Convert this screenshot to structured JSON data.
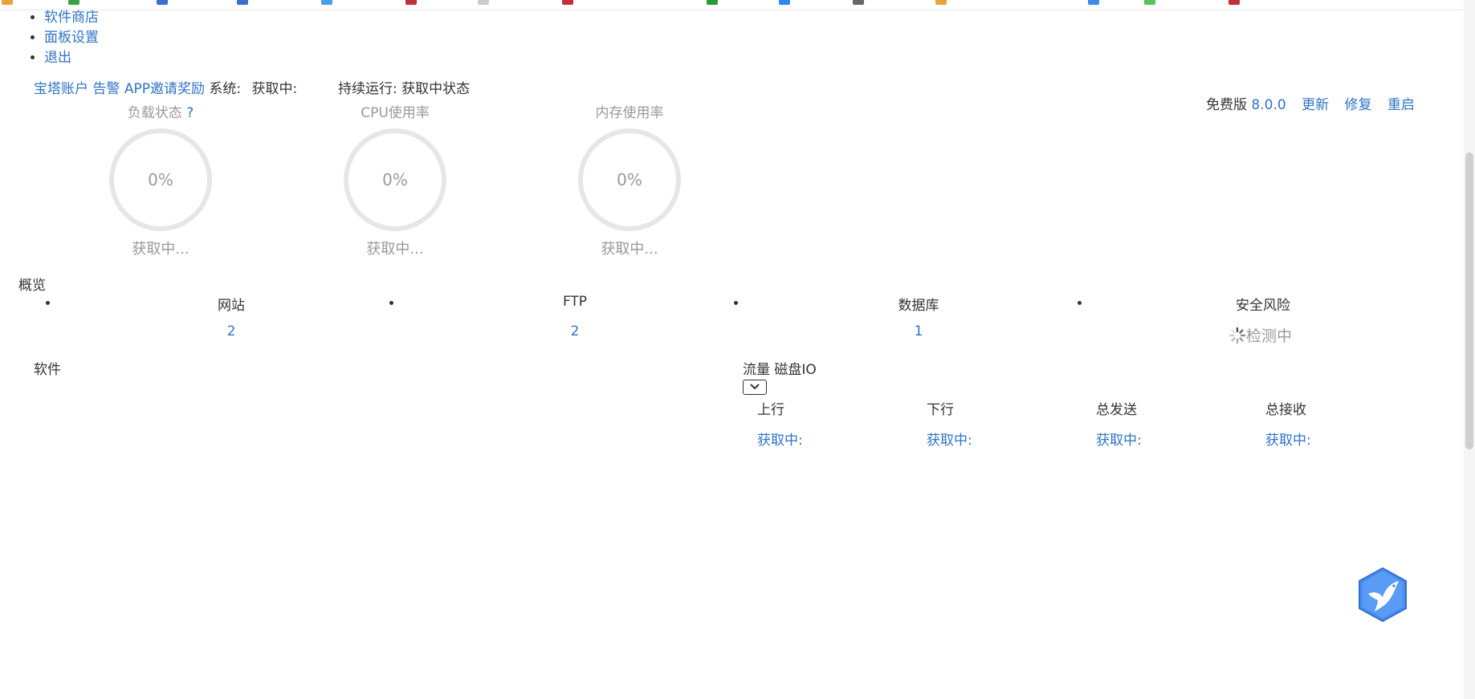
{
  "nav": {
    "items": [
      "软件商店",
      "面板设置",
      "退出"
    ]
  },
  "header": {
    "links": [
      "宝塔账户",
      "告警",
      "APP",
      "邀请奖励"
    ],
    "system_label": "系统:",
    "system_value": "获取中:",
    "uptime": "持续运行: 获取中状态"
  },
  "version": {
    "label": "免费版",
    "number": "8.0.0",
    "update": "更新",
    "repair": "修复",
    "restart": "重启"
  },
  "gauges": [
    {
      "title": "负载状态",
      "help": "?",
      "value": "0%",
      "status": "获取中..."
    },
    {
      "title": "CPU使用率",
      "value": "0%",
      "status": "获取中..."
    },
    {
      "title": "内存使用率",
      "value": "0%",
      "status": "获取中..."
    }
  ],
  "overview": {
    "title": "概览",
    "items": [
      {
        "label": "网站",
        "value": "2"
      },
      {
        "label": "FTP",
        "value": "2"
      },
      {
        "label": "数据库",
        "value": "1"
      },
      {
        "label": "安全风险",
        "value": "检测中"
      }
    ]
  },
  "software": {
    "title": "软件"
  },
  "traffic": {
    "tabs": [
      "流量",
      "磁盘IO"
    ],
    "columns": [
      {
        "label": "上行",
        "value": "获取中:"
      },
      {
        "label": "下行",
        "value": "获取中:"
      },
      {
        "label": "总发送",
        "value": "获取中:"
      },
      {
        "label": "总接收",
        "value": "获取中:"
      }
    ]
  },
  "colors": {
    "link": "#2f73c5",
    "muted": "#999999",
    "ring": "#e6e6e6",
    "bird": "#4a8ef0"
  },
  "icons": [
    "chevron-down-icon",
    "spinner-icon",
    "baota-bird-icon"
  ]
}
